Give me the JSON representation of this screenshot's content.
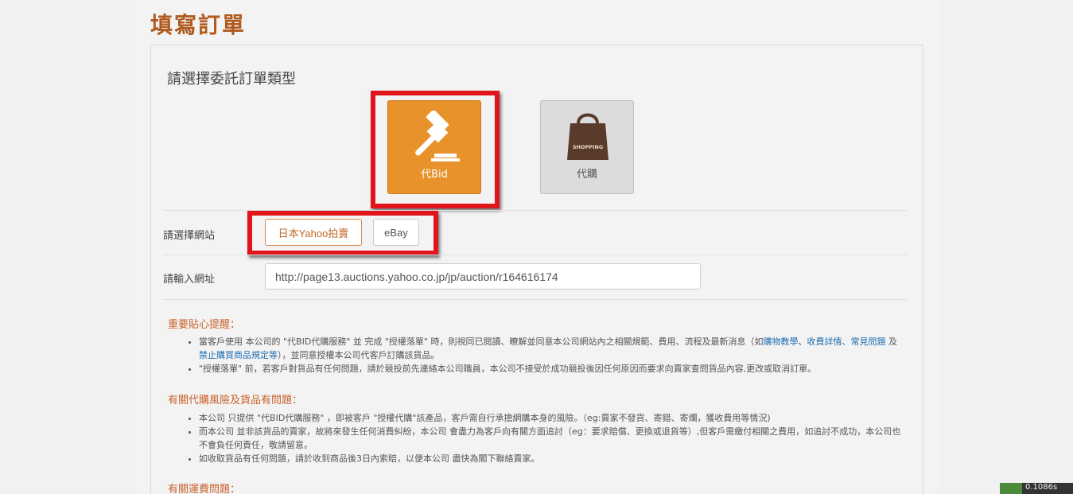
{
  "page": {
    "title": "填寫訂單"
  },
  "order_type": {
    "heading": "請選擇委託訂單類型",
    "options": [
      {
        "label": "代Bid",
        "icon": "gavel-icon",
        "selected": true
      },
      {
        "label": "代購",
        "icon": "shopping-bag-icon",
        "icon_text": "SHOPPING",
        "selected": false
      }
    ]
  },
  "site": {
    "label": "請選擇網站",
    "options": [
      {
        "label": "日本Yahoo拍賣",
        "selected": true
      },
      {
        "label": "eBay",
        "selected": false
      }
    ]
  },
  "url": {
    "label": "請輸入網址",
    "value": "http://page13.auctions.yahoo.co.jp/jp/auction/r164616174"
  },
  "notice": {
    "title": "重要貼心提醒：",
    "items": [
      {
        "prefix": "當客戶使用 本公司的 \"代BID代購服務\" 並 完成 \"授權落單\" 時，則視同已閱讀、瞭解並同意本公司網站內之相關規範、費用、流程及最新消息（如",
        "links": [
          "購物教學",
          "收費詳情",
          "常見問題",
          "禁止購買商品規定等"
        ],
        "joiners": [
          "、",
          "、",
          " 及 "
        ],
        "suffix": "），並同意授權本公司代客戶訂購該貨品。"
      },
      {
        "text": "\"授權落單\" 前，若客戶對貨品有任何問題，請於競投前先連絡本公司職員，本公司不接受於成功競投後因任何原因而要求向賣家查問貨品內容,更改或取消訂單。"
      }
    ]
  },
  "risk": {
    "title": "有關代購風險及貨品有問題：",
    "items": [
      "本公司 只提供 \"代BID代購服務\" ，即被客戶 \"授權代購\"該產品，客戶需自行承擔網購本身的風險。（eg:賣家不發貨、寄錯、寄爛，獲收費用等情況)",
      "而本公司 並非該貨品的賣家，故將來發生任何消費糾紛，本公司 會盡力為客戶向有關方面追討（eg：要求賠償、更換或退貨等）,但客戶需繳付相關之費用，如追討不成功，本公司也不會負任何責任，敬請留意。",
      "如收取貨品有任何問題，請於收到商品後3日內索賠，以便本公司 盡快為閣下聯絡賣家。"
    ]
  },
  "shipping": {
    "title": "有關運費問題："
  },
  "badge": {
    "text": "0.1086s"
  },
  "colors": {
    "accent": "#e8922b",
    "title": "#b05a1e",
    "highlight": "#e0151b",
    "link": "#1f6fb2"
  }
}
